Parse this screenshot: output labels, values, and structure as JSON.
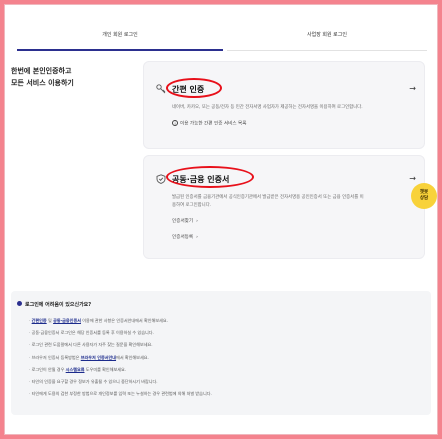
{
  "tabs": {
    "personal": "개인 회원 로그인",
    "business": "사업장 회원 로그인"
  },
  "headline": {
    "line1": "한번에 본인인증하고",
    "line2": "모든 서비스 이용하기"
  },
  "easy_auth": {
    "title": "간편 인증",
    "arrow": "→",
    "description": "네이버, 카카오, 또는 공동/전자 등 민간 전자서명 사업자가 제공하는 전자서명을 이용하여 로그인합니다.",
    "registration_link": "이용 가능한 간편 인증 서비스 목록"
  },
  "cert_auth": {
    "title": "공동·금융 인증서",
    "arrow": "→",
    "description_line1": "발급된 인증서를 금융기관에서 공식인증기관에서 발급받은 전자서명용 공인인증서 또는 금융 인증서를 이",
    "description_line2": "용하여 로그인합니다.",
    "link1": "인증서찾기",
    "link2": "인증서등록"
  },
  "badge": {
    "line1": "챗봇",
    "line2": "상담"
  },
  "help": {
    "title": "로그인에 어려움이 있으신가요?",
    "items": [
      {
        "pre": "",
        "link": "간편인증",
        "mid": " 및 ",
        "link2": "공동·금융인증서",
        "post": " 이용에 관한 사항은 인증서안내에서 확인해보세요."
      },
      {
        "pre": "공동·금융인증서 로그인은 해당 인증서를 등록 후 이용하실 수 있습니다.",
        "link": "",
        "mid": "",
        "link2": "",
        "post": ""
      },
      {
        "pre": "로그인 관련 도움말에서 다른 사용자가 자주 찾는 질문을 확인해보세요.",
        "link": "",
        "mid": "",
        "link2": "",
        "post": ""
      },
      {
        "pre": "브라우저 인증서 등록방법은 ",
        "link": "브라우저 인증서안내",
        "mid": "",
        "link2": "",
        "post": "에서 확인해보세요."
      },
      {
        "pre": "로그인이 안될 경우 ",
        "link": "시스템요류",
        "mid": "",
        "link2": "",
        "post": " 도우미를 확인해보세요."
      },
      {
        "pre": "타인의 인증을 요구할 경우 정보가 유출될 수 있으니 중단하시기 바랍니다.",
        "link": "",
        "mid": "",
        "link2": "",
        "post": ""
      },
      {
        "pre": "타인에게 도용의 겁한 부정한 방법으로 개인정보를 입력 또는 누설하는 경우 관련법에 의해 처벌 받습니다.",
        "link": "",
        "mid": "",
        "link2": "",
        "post": ""
      }
    ]
  },
  "colors": {
    "background": "#f4838e",
    "accent": "#2b2f8f",
    "annotation": "#e8101a",
    "badge": "#f8d23a"
  }
}
